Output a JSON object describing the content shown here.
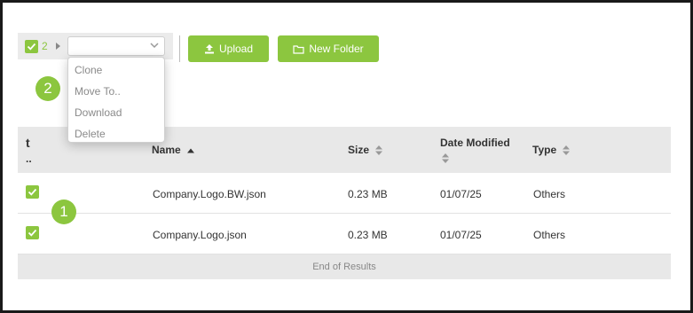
{
  "toolbar": {
    "selected_count": "2",
    "action_select_value": "",
    "upload_label": "Upload",
    "new_folder_label": "New Folder"
  },
  "action_menu": {
    "items": [
      {
        "label": "Clone"
      },
      {
        "label": "Move To.."
      },
      {
        "label": "Download"
      },
      {
        "label": "Delete"
      }
    ]
  },
  "annotations": {
    "badge_1": "1",
    "badge_2": "2"
  },
  "table": {
    "parent_glyph": "t",
    "parent_label": "..",
    "headers": {
      "name": "Name",
      "size": "Size",
      "date_modified": "Date Modified",
      "type": "Type"
    },
    "rows": [
      {
        "checked": true,
        "name": "Company.Logo.BW.json",
        "size": "0.23 MB",
        "date": "01/07/25",
        "type": "Others"
      },
      {
        "checked": true,
        "name": "Company.Logo.json",
        "size": "0.23 MB",
        "date": "01/07/25",
        "type": "Others"
      }
    ],
    "footer": "End of Results"
  },
  "colors": {
    "accent": "#8cc63f",
    "header_bg": "#e8e8e8",
    "menu_text": "#8a8a8a"
  }
}
